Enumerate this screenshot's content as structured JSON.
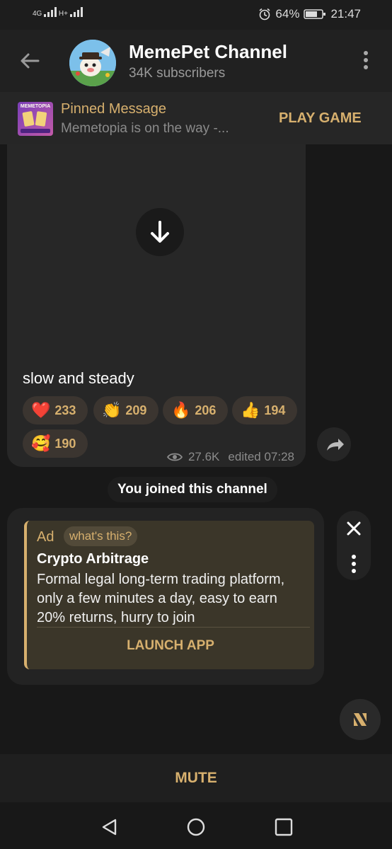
{
  "statusbar": {
    "signal_left": "4G",
    "signal_right": "H+",
    "battery": "64%",
    "time": "21:47"
  },
  "header": {
    "title": "MemePet Channel",
    "subtitle": "34K subscribers"
  },
  "pinned": {
    "thumb_label": "MEMETOPIA",
    "title": "Pinned Message",
    "text": "Memetopia is on the way -...",
    "action": "PLAY GAME"
  },
  "message": {
    "caption": "slow and steady",
    "reactions": [
      {
        "icon": "heart",
        "emoji": "❤️",
        "count": "233"
      },
      {
        "icon": "clapping-hands",
        "emoji": "👏",
        "count": "209"
      },
      {
        "icon": "fire",
        "emoji": "🔥",
        "count": "206"
      },
      {
        "icon": "thumbs-up",
        "emoji": "👍",
        "count": "194"
      },
      {
        "icon": "smiling-face-with-hearts",
        "emoji": "🥰",
        "count": "190"
      }
    ],
    "views": "27.6K",
    "edited": "edited 07:28"
  },
  "service": {
    "joined": "You joined this channel"
  },
  "ad": {
    "label": "Ad",
    "whats_this": "what's this?",
    "title": "Crypto Arbitrage",
    "body": "Formal legal long-term trading platform, only a few minutes a day, easy to earn 20% returns, hurry to join",
    "button": "LAUNCH APP"
  },
  "bottom": {
    "mute": "MUTE"
  },
  "colors": {
    "accent": "#d7b06e",
    "background": "#181818",
    "bubble": "#272727"
  }
}
